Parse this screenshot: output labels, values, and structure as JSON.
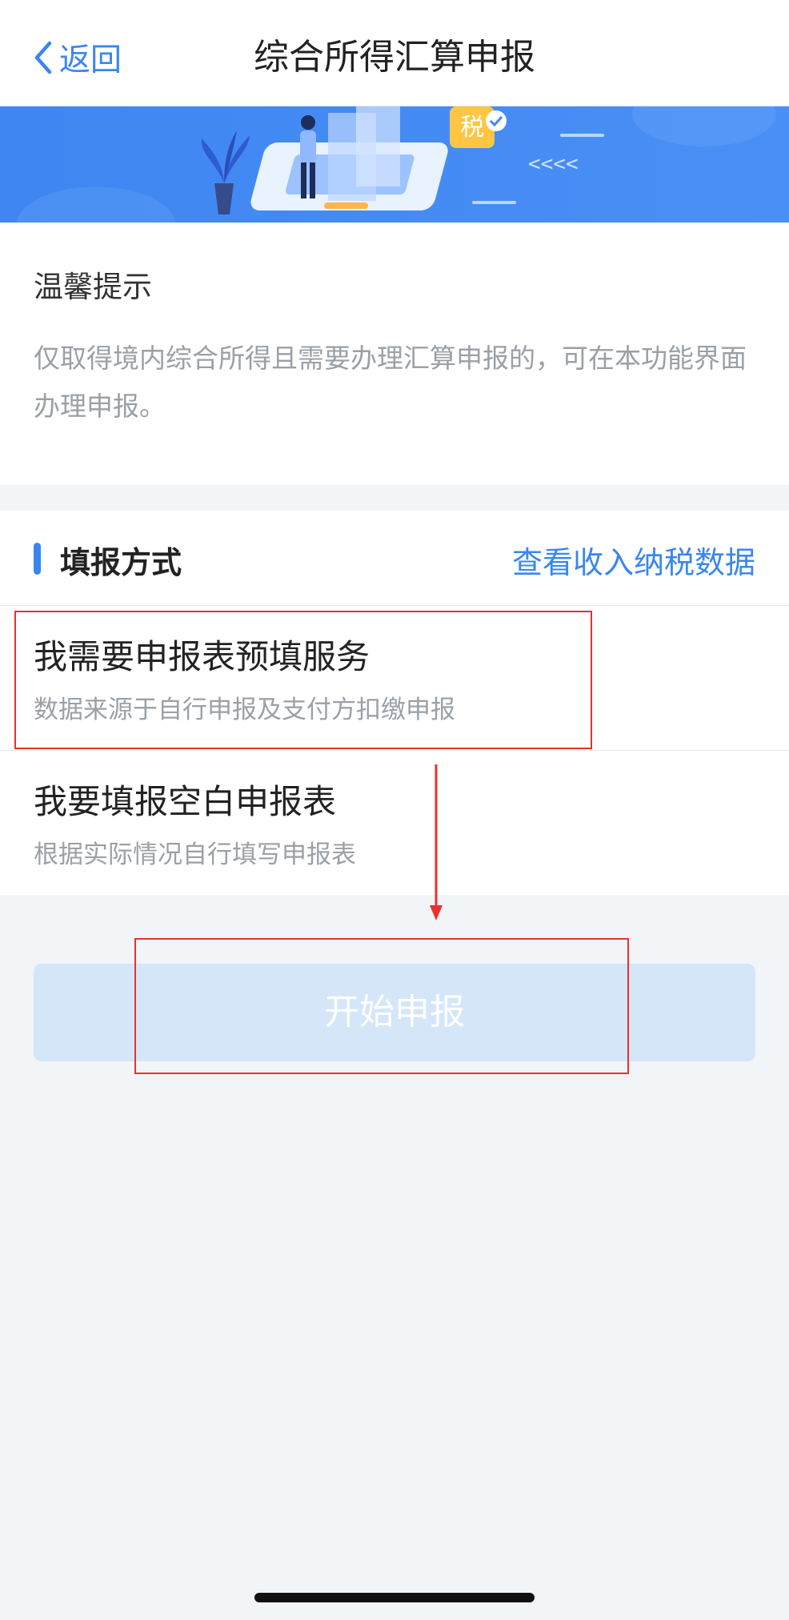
{
  "nav": {
    "back_label": "返回",
    "title": "综合所得汇算申报"
  },
  "banner": {
    "badge_text": "税",
    "arrows_text": "<<<<"
  },
  "tips": {
    "title": "温馨提示",
    "text": "仅取得境内综合所得且需要办理汇算申报的，可在本功能界面办理申报。"
  },
  "section": {
    "title": "填报方式",
    "link": "查看收入纳税数据"
  },
  "options": [
    {
      "title": "我需要申报表预填服务",
      "subtitle": "数据来源于自行申报及支付方扣缴申报"
    },
    {
      "title": "我要填报空白申报表",
      "subtitle": "根据实际情况自行填写申报表"
    }
  ],
  "start_button": {
    "label": "开始申报"
  },
  "colors": {
    "accent": "#3a86ee",
    "annotation": "#e8312d",
    "button_disabled": "#d5e6f9"
  }
}
